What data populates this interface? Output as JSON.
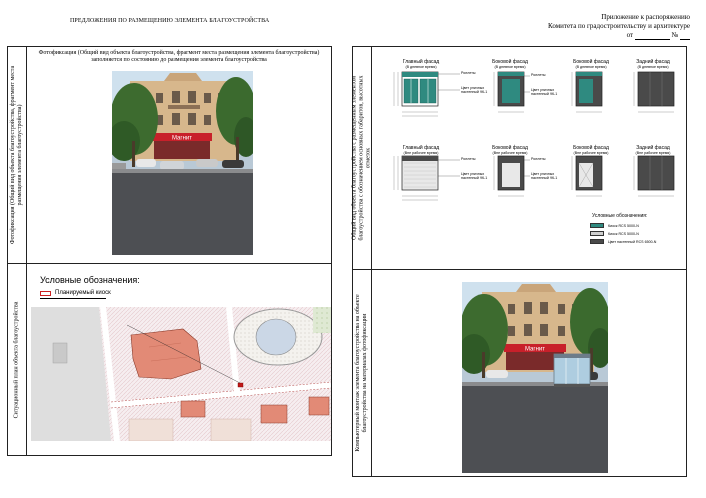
{
  "header": {
    "left_title": "ПРЕДЛОЖЕНИЯ ПО РАЗМЕЩЕНИЮ ЭЛЕМЕНТА БЛАГОУСТРОЙСТВА",
    "right_line1": "Приложение к распоряжению",
    "right_line2": "Комитета по градостроительству и архитектуре",
    "right_line3_prefix": "от",
    "right_line3_no": "№"
  },
  "panel_photo": {
    "side_label_1": "Фотофиксация (Общий вид объекта благоустройства, фрагмент места",
    "side_label_2": "размещения элемента благоустройства)",
    "caption_line1": "Фотофиксация (Общий вид объекта благоустройства, фрагмент места размещения элемента благоустройства)",
    "caption_line2": "заполняется по состоянию до размещения элемента благоустройства",
    "shop_sign": "Магнит"
  },
  "panel_plan": {
    "side_label": "Ситуационный план объекта благоустройства",
    "legend_title": "Условные обозначения:",
    "legend_item": "Планируемый киоск"
  },
  "panel_facades": {
    "side_label_1": "Общий вид объекта благоустройства с размещенным элементом",
    "side_label_2": "благоустройства с обозначением основных габаритов, высотных",
    "side_label_3": "отметок",
    "top_row": [
      {
        "title": "Главный фасад",
        "sub": "(В дневное время)"
      },
      {
        "title": "Боковой фасад",
        "sub": "(В дневное время)"
      },
      {
        "title": "Боковой фасад",
        "sub": "(В дневное время)"
      },
      {
        "title": "Задний фасад",
        "sub": "(В дневное время)"
      }
    ],
    "bottom_row": [
      {
        "title": "Главный фасад",
        "sub": "(Вне рабочее время)"
      },
      {
        "title": "Боковой фасад",
        "sub": "(Вне рабочее время)"
      },
      {
        "title": "Боковой фасад",
        "sub": "(Вне рабочее время)"
      },
      {
        "title": "Задний фасад",
        "sub": "(Вне рабочее время)"
      }
    ],
    "annot_roll": "Роллеты",
    "annot_color": "Цвет уличных\nнастенный 9К-1",
    "legend_title": "Условные обозначения:",
    "legend_items": [
      {
        "label": "Киоск RCS 5000-N",
        "color": "#2f8a80"
      },
      {
        "label": "Киоск RCS 5000-N",
        "color": "#cfcfcf"
      },
      {
        "label": "Цвет настенный RCS 6500-N",
        "color": "#4a4a4a"
      }
    ]
  },
  "panel_montage": {
    "side_label_1": "Компьютерный монтаж элемента благоустройства на объекте",
    "side_label_2": "благоустройства на материалах фотофиксации",
    "shop_sign": "Магнит"
  }
}
